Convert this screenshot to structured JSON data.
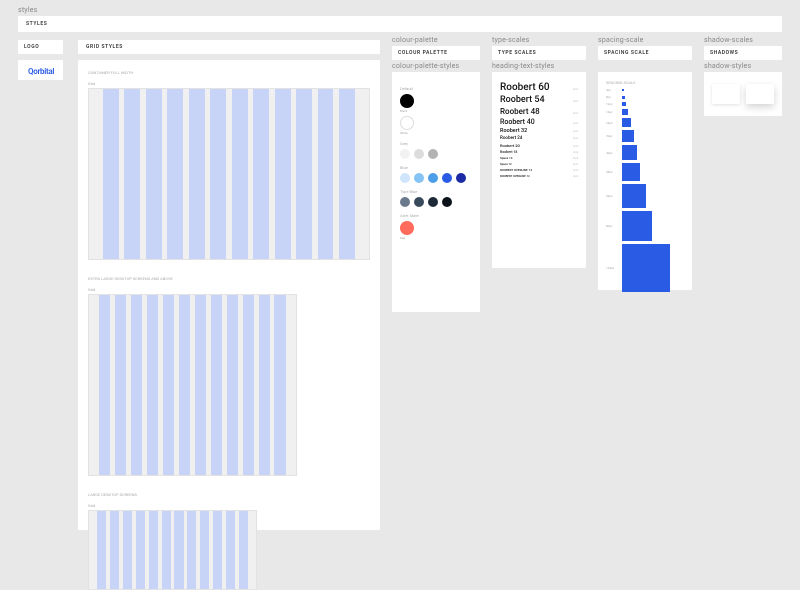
{
  "section_root": "styles",
  "styles_frame": "STYLES",
  "logo_frame": "LOGO",
  "logo_text": "Qorbital",
  "grid_frame": "GRID STYLES",
  "grid_label_1": "CONTAINER FULL WIDTH",
  "grid_label_2": "EXTRA LARGE DESKTOP SCREENS AND ABOVE",
  "grid_label_3": "LARGE DESKTOP SCREENS",
  "grid_tiny": "Grid",
  "colour_section": "colour-palette",
  "colour_frame": "COLOUR PALETTE",
  "colour_styles_section": "colour-palette-styles",
  "palette": {
    "default_heading": "Default",
    "default_black": "Black",
    "default_white": "White",
    "grey_heading": "Grey",
    "blue_heading": "Blue",
    "textblue_heading": "Type Blue",
    "alert_heading": "Alert State",
    "red_label": "Red"
  },
  "type_section": "type-scales",
  "type_frame": "TYPE SCALES",
  "type_styles_section": "heading-text-styles",
  "type_scales": [
    {
      "label": "Roobert 60",
      "size": 10
    },
    {
      "label": "Roobert 54",
      "size": 9
    },
    {
      "label": "Roobert 48",
      "size": 8
    },
    {
      "label": "Roobert 40",
      "size": 7
    },
    {
      "label": "Roobert 32",
      "size": 5.5
    },
    {
      "label": "Roobert 24",
      "size": 4.5
    },
    {
      "label": "Roobert 20",
      "size": 4
    },
    {
      "label": "Roobert 18",
      "size": 3.5
    },
    {
      "label": "Space 14",
      "size": 3
    },
    {
      "label": "Space 12",
      "size": 2.8
    },
    {
      "label": "ROOBERT OVERLINE 14",
      "size": 3
    },
    {
      "label": "ROOBERT OVERLINE 12",
      "size": 2.8
    }
  ],
  "spacing_section": "spacing-scale",
  "spacing_frame": "SPACING SCALE",
  "spacing_heading": "SPACING SCALE",
  "spacing_items": [
    {
      "label": "4px",
      "size": 2
    },
    {
      "label": "8px",
      "size": 3
    },
    {
      "label": "12px",
      "size": 4
    },
    {
      "label": "16px",
      "size": 6
    },
    {
      "label": "24px",
      "size": 9
    },
    {
      "label": "32px",
      "size": 12
    },
    {
      "label": "40px",
      "size": 15
    },
    {
      "label": "48px",
      "size": 18
    },
    {
      "label": "64px",
      "size": 24
    },
    {
      "label": "80px",
      "size": 30
    },
    {
      "label": "128px",
      "size": 48
    }
  ],
  "shadow_section": "shadow-scales",
  "shadow_frame": "SHADOWS",
  "shadow_styles_section": "shadow-styles"
}
